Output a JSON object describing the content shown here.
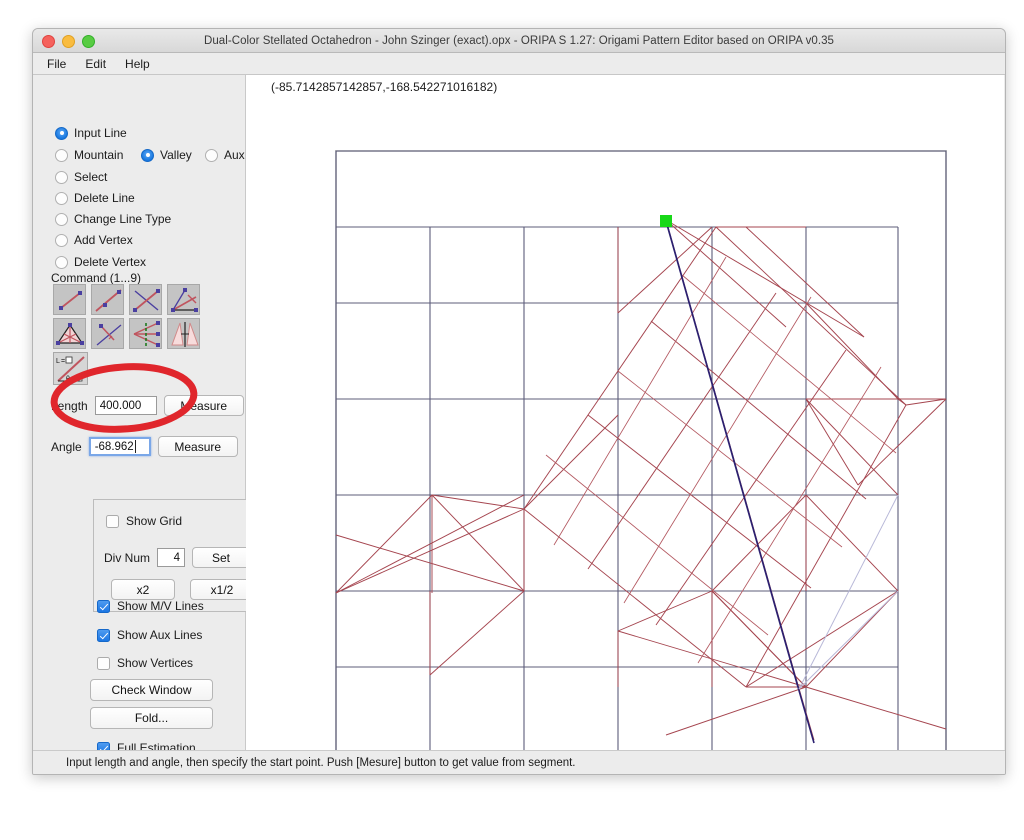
{
  "window": {
    "title": "Dual-Color Stellated Octahedron - John Szinger (exact).opx - ORIPA S 1.27: Origami Pattern Editor based on ORIPA  v0.35",
    "traffic_lights": [
      "close",
      "minimize",
      "zoom"
    ]
  },
  "menubar": {
    "items": [
      {
        "label": "File"
      },
      {
        "label": "Edit"
      },
      {
        "label": "Help"
      }
    ]
  },
  "sidebar": {
    "edit_modes": [
      {
        "label": "Input Line",
        "selected": true
      },
      {
        "label": "Select",
        "selected": false
      },
      {
        "label": "Delete Line",
        "selected": false
      },
      {
        "label": "Change Line Type",
        "selected": false
      },
      {
        "label": "Add Vertex",
        "selected": false
      },
      {
        "label": "Delete Vertex",
        "selected": false
      }
    ],
    "line_types": [
      {
        "label": "Mountain",
        "selected": false
      },
      {
        "label": "Valley",
        "selected": true
      },
      {
        "label": "Aux",
        "selected": false
      }
    ],
    "command_section_label": "Command (1...9)",
    "command_buttons": [
      {
        "name": "two-point-segment"
      },
      {
        "name": "segment-extend"
      },
      {
        "name": "perpendicular-bisector"
      },
      {
        "name": "angle-bisector"
      },
      {
        "name": "triangle-insert"
      },
      {
        "name": "perpendicular-foot"
      },
      {
        "name": "symmetric-fold"
      },
      {
        "name": "mirror-copy"
      },
      {
        "name": "length-angle-input",
        "selected": true
      }
    ],
    "length": {
      "label": "Length",
      "value": "400.000",
      "measure_label": "Measure"
    },
    "angle": {
      "label": "Angle",
      "value": "-68.962",
      "measure_label": "Measure"
    },
    "grid_panel": {
      "show_grid": {
        "label": "Show Grid",
        "checked": false
      },
      "div_num": {
        "label": "Div Num",
        "value": "4"
      },
      "set_label": "Set",
      "x2_label": "x2",
      "xhalf_label": "x1/2"
    },
    "display_options": [
      {
        "label": "Show M/V Lines",
        "checked": true
      },
      {
        "label": "Show Aux Lines",
        "checked": true
      },
      {
        "label": "Show Vertices",
        "checked": false
      }
    ],
    "check_window_label": "Check Window",
    "fold_label": "Fold...",
    "full_estimation": {
      "label": "Full Estimation",
      "checked": true
    }
  },
  "canvas": {
    "coordinates": "(-85.7142857142857,-168.542271016182)",
    "start_point_marker_color": "#18d818",
    "mountain_color": "#b0434f",
    "valley_color": "#3b2fa0",
    "grid_color": "#5c5c7a",
    "aux_color": "#b8b8d8"
  },
  "annotation": {
    "shape": "ellipse",
    "color": "#e0262c",
    "target": "angle-field"
  },
  "statusbar": {
    "message": "Input length and angle, then specify the start point. Push [Mesure] button to get value from segment."
  }
}
